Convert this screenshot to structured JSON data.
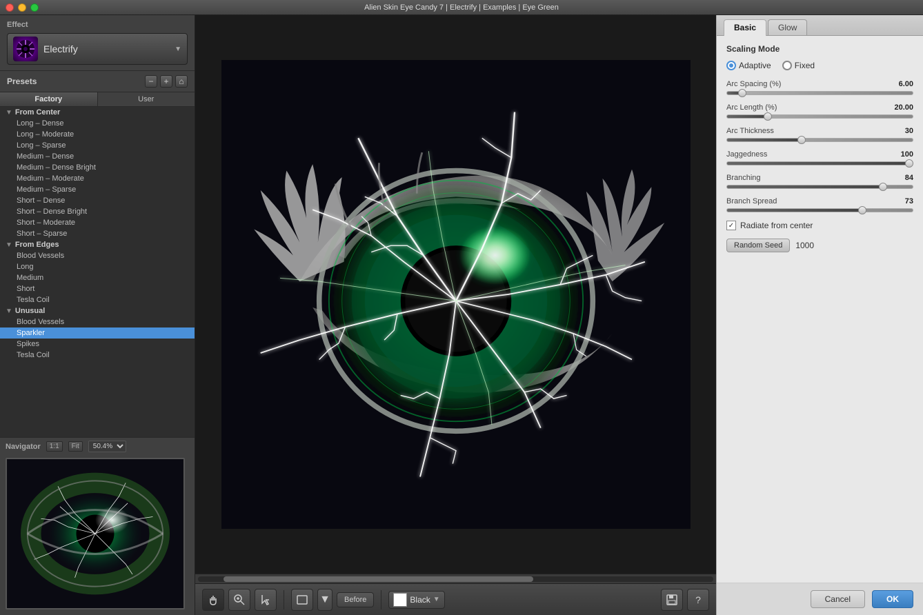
{
  "titlebar": {
    "title": "Alien Skin Eye Candy 7 | Electrify | Examples | Eye Green"
  },
  "left_panel": {
    "effect_label": "Effect",
    "effect_name": "Electrify",
    "presets_label": "Presets",
    "tabs": [
      {
        "id": "factory",
        "label": "Factory",
        "active": true
      },
      {
        "id": "user",
        "label": "User",
        "active": false
      }
    ],
    "tree": [
      {
        "id": "from-center",
        "label": "From Center",
        "expanded": true,
        "items": [
          "Long – Dense",
          "Long – Moderate",
          "Long – Sparse",
          "Medium – Dense",
          "Medium – Dense Bright",
          "Medium – Moderate",
          "Medium – Sparse",
          "Short – Dense",
          "Short – Dense Bright",
          "Short – Moderate",
          "Short – Sparse"
        ]
      },
      {
        "id": "from-edges",
        "label": "From Edges",
        "expanded": true,
        "items": [
          "Blood Vessels",
          "Long",
          "Medium",
          "Short",
          "Tesla Coil"
        ]
      },
      {
        "id": "unusual",
        "label": "Unusual",
        "expanded": true,
        "items": [
          "Blood Vessels",
          "Sparkler",
          "Spikes",
          "Tesla Coil"
        ]
      }
    ],
    "selected_item": "Sparkler"
  },
  "navigator": {
    "label": "Navigator",
    "zoom_1_1": "1:1",
    "zoom_fit": "Fit",
    "zoom_percent": "50.4%"
  },
  "bottom_toolbar": {
    "before_label": "Before",
    "color_label": "Black",
    "color_value": "Black"
  },
  "right_panel": {
    "tabs": [
      {
        "id": "basic",
        "label": "Basic",
        "active": true
      },
      {
        "id": "glow",
        "label": "Glow",
        "active": false
      }
    ],
    "scaling_mode": {
      "label": "Scaling Mode",
      "options": [
        {
          "id": "adaptive",
          "label": "Adaptive",
          "selected": true
        },
        {
          "id": "fixed",
          "label": "Fixed",
          "selected": false
        }
      ]
    },
    "sliders": [
      {
        "id": "arc-spacing",
        "label": "Arc Spacing (%)",
        "value": "6.00",
        "pct": 8
      },
      {
        "id": "arc-length",
        "label": "Arc Length (%)",
        "value": "20.00",
        "pct": 22
      },
      {
        "id": "arc-thickness",
        "label": "Arc Thickness",
        "value": "30",
        "pct": 40
      },
      {
        "id": "jaggedness",
        "label": "Jaggedness",
        "value": "100",
        "pct": 100
      },
      {
        "id": "branching",
        "label": "Branching",
        "value": "84",
        "pct": 84
      },
      {
        "id": "branch-spread",
        "label": "Branch Spread",
        "value": "73",
        "pct": 73
      }
    ],
    "radiate_checkbox": {
      "label": "Radiate from center",
      "checked": true
    },
    "random_seed": {
      "button_label": "Random Seed",
      "value": "1000"
    },
    "buttons": {
      "cancel": "Cancel",
      "ok": "OK"
    }
  }
}
